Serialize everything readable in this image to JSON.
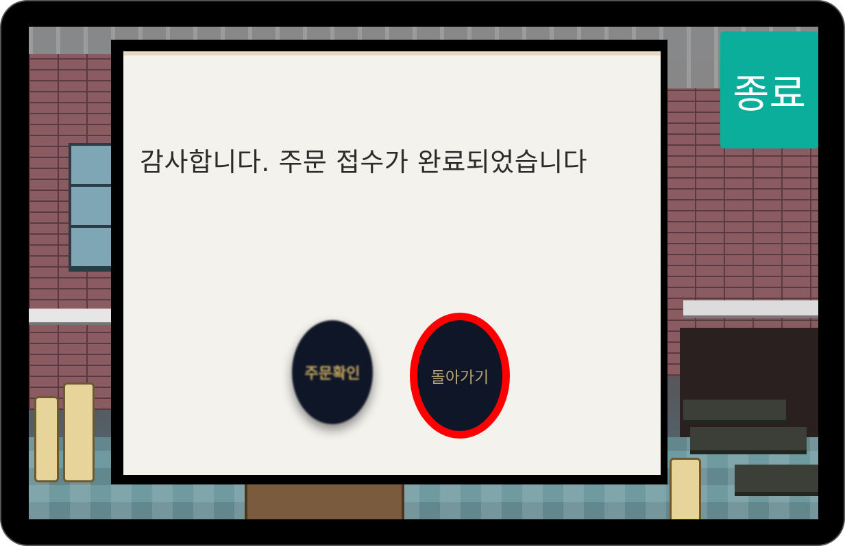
{
  "popup": {
    "message": "감사합니다. 주문 접수가 완료되었습니다",
    "confirm_order_label": "주문확인",
    "back_label": "돌아가기"
  },
  "header": {
    "exit_label": "종료"
  },
  "colors": {
    "exit_button": "#0aae9b",
    "round_button": "#0f1627",
    "highlight_ring": "#ff0000",
    "popup_background": "#f4f2ed"
  }
}
